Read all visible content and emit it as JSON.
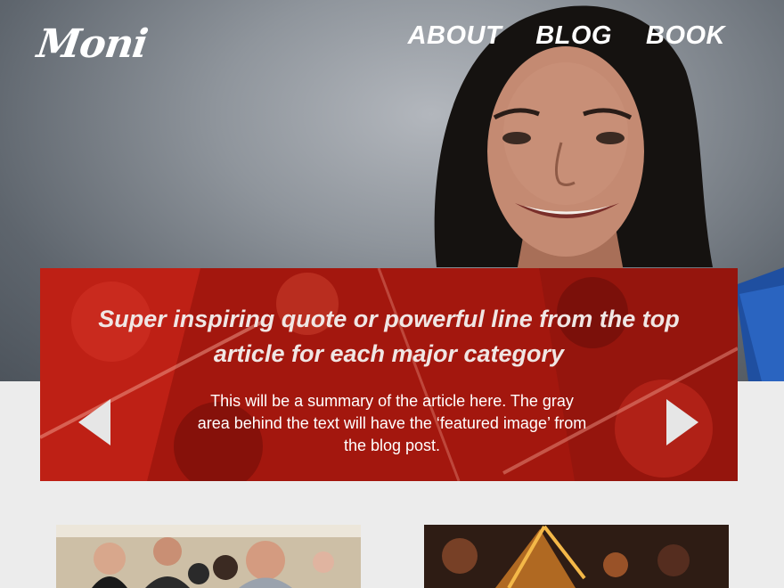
{
  "brand": {
    "logo_text": "Moni"
  },
  "nav": {
    "items": [
      "ABOUT",
      "BLOG",
      "BOOK"
    ]
  },
  "slider": {
    "quote": "Super inspiring quote or powerful line from the top article for each major category",
    "summary": "This will be a summary of the article here. The gray area behind the text will have the ‘featured image’ from the blog post.",
    "prev_icon": "chevron-left-icon",
    "next_icon": "chevron-right-icon"
  },
  "colors": {
    "slider_red": "#b81d12",
    "page_bg": "#ececec",
    "hero_gray": "#8f959c"
  }
}
